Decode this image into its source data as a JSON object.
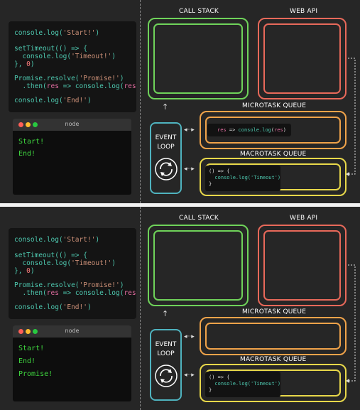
{
  "code": {
    "line1": "console.log('Start!')",
    "line2": "setTimeout(() => {",
    "line3": "  console.log('Timeout!')",
    "line4": "}, 0)",
    "line5": "Promise.resolve('Promise!')",
    "line6": "  .then(res => console.log(res))",
    "line7": "console.log('End!')"
  },
  "terminal_title": "node",
  "labels": {
    "call_stack": "CALL STACK",
    "web_api": "WEB API",
    "microtask_queue": "MICROTASK QUEUE",
    "macrotask_queue": "MACROTASK QUEUE",
    "event": "EVENT",
    "loop": "LOOP"
  },
  "panel1": {
    "output": [
      "Start!",
      "End!"
    ],
    "microtask_item": "res => console.log(res)",
    "macrotask_item": [
      "() => {",
      "  console.log('Timeout')",
      "}"
    ]
  },
  "panel2": {
    "output": [
      "Start!",
      "End!",
      "Promise!"
    ],
    "macrotask_item": [
      "() => {",
      "  console.log('Timeout')",
      "}"
    ]
  },
  "colors": {
    "call_stack": "#6fd35a",
    "web_api": "#e8695a",
    "microtask_queue": "#f0a34a",
    "macrotask_queue": "#e8d84a",
    "event_loop": "#4fb3bf",
    "terminal_output": "#3fd63f"
  }
}
